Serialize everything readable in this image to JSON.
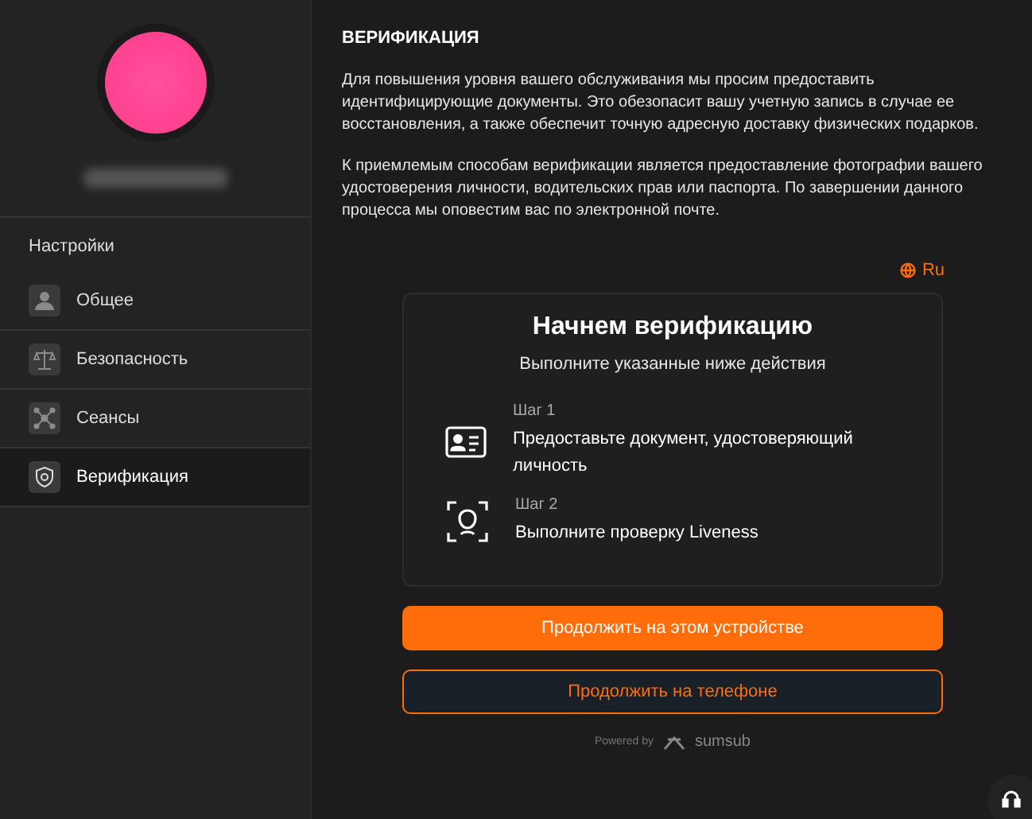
{
  "sidebar": {
    "section_title": "Настройки",
    "items": [
      {
        "label": "Общее",
        "selected": false
      },
      {
        "label": "Безопасность",
        "selected": false
      },
      {
        "label": "Сеансы",
        "selected": false
      },
      {
        "label": "Верификация",
        "selected": true
      }
    ]
  },
  "main": {
    "title": "ВЕРИФИКАЦИЯ",
    "paragraphs": [
      "Для повышения уровня вашего обслуживания мы просим предоставить идентифицирующие документы. Это обезопасит вашу учетную запись в случае ее восстановления, а также обеспечит точную адресную доставку физических подарков.",
      "К приемлемым способам верификации является предоставление фотографии вашего удостоверения личности, водительских прав или паспорта. По завершении данного процесса мы оповестим вас по электронной почте."
    ],
    "language": "Ru",
    "card": {
      "title": "Начнем верификацию",
      "subtitle": "Выполните указанные ниже действия",
      "steps": [
        {
          "step": "Шаг 1",
          "text": "Предоставьте документ, удостоверяющий личность"
        },
        {
          "step": "Шаг 2",
          "text": "Выполните проверку Liveness"
        }
      ]
    },
    "buttons": [
      {
        "label": "Продолжить на этом устройстве",
        "kind": "primary"
      },
      {
        "label": "Продолжить на телефоне",
        "kind": "outline"
      }
    ],
    "powered_by": "Powered by",
    "brand": "sumsub"
  }
}
